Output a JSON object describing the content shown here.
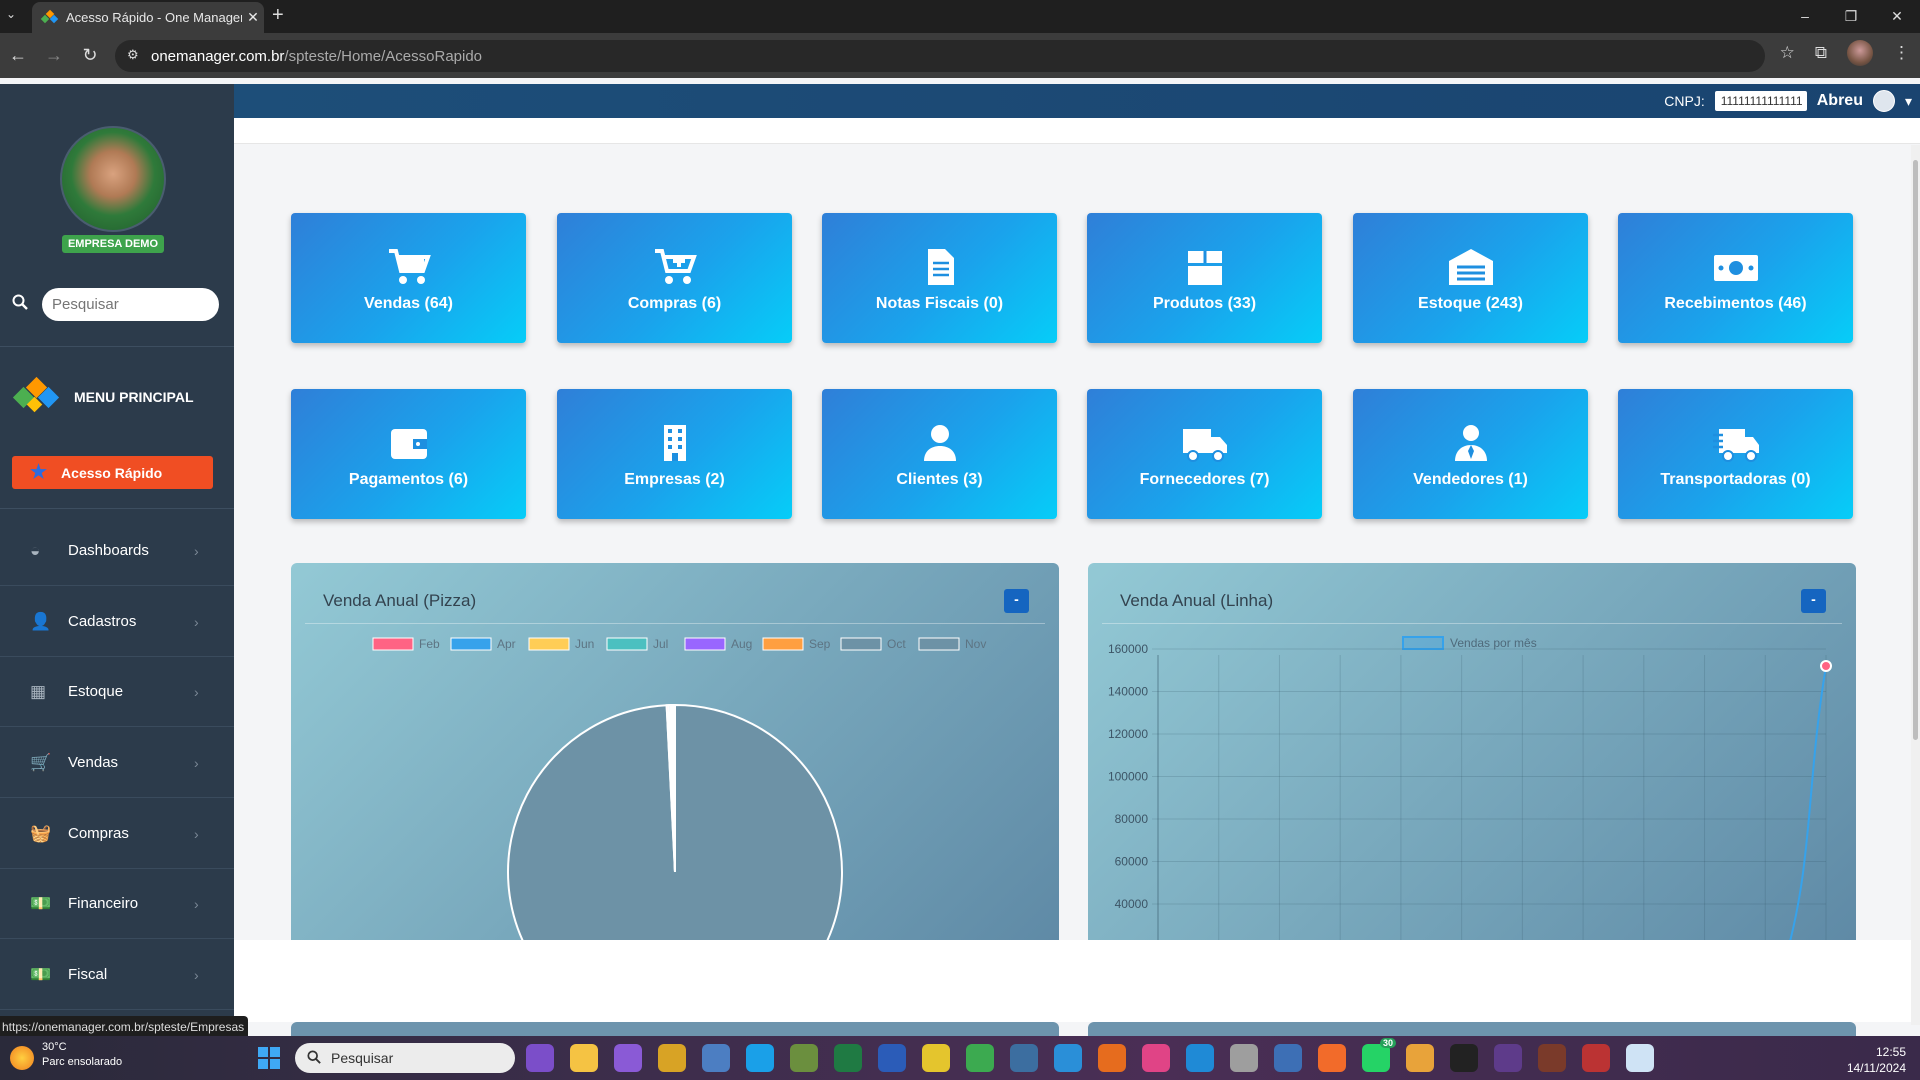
{
  "browser": {
    "tab_title": "Acesso Rápido - One Manager",
    "tab_close": "✕",
    "new_tab": "+",
    "url_domain": "onemanager.com.br",
    "url_path": "/spteste/Home/AcessoRapido",
    "status_url": "https://onemanager.com.br/spteste/Empresas"
  },
  "header": {
    "cnpj_label": "CNPJ:",
    "cnpj_value": "11111111111111",
    "user_name": "Abreu",
    "user_caret": "▾"
  },
  "sidebar": {
    "company_badge": "EMPRESA DEMO",
    "search_placeholder": "Pesquisar",
    "menu_title": "MENU PRINCIPAL",
    "active_item": "Acesso Rápido",
    "items": [
      {
        "label": "Dashboards",
        "icon": "gauge-icon"
      },
      {
        "label": "Cadastros",
        "icon": "user-plus-icon"
      },
      {
        "label": "Estoque",
        "icon": "grid-icon"
      },
      {
        "label": "Vendas",
        "icon": "cart-icon"
      },
      {
        "label": "Compras",
        "icon": "basket-icon"
      },
      {
        "label": "Financeiro",
        "icon": "money-icon"
      },
      {
        "label": "Fiscal",
        "icon": "money-icon"
      }
    ]
  },
  "tiles": [
    {
      "label": "Vendas (64)",
      "icon": "cart-icon"
    },
    {
      "label": "Compras (6)",
      "icon": "cart-plus-icon"
    },
    {
      "label": "Notas Fiscais (0)",
      "icon": "document-icon"
    },
    {
      "label": "Produtos (33)",
      "icon": "box-icon"
    },
    {
      "label": "Estoque (243)",
      "icon": "warehouse-icon"
    },
    {
      "label": "Recebimentos (46)",
      "icon": "money-icon"
    },
    {
      "label": "Pagamentos (6)",
      "icon": "wallet-icon"
    },
    {
      "label": "Empresas (2)",
      "icon": "building-icon"
    },
    {
      "label": "Clientes (3)",
      "icon": "user-icon"
    },
    {
      "label": "Fornecedores (7)",
      "icon": "truck-icon"
    },
    {
      "label": "Vendedores (1)",
      "icon": "user-tie-icon"
    },
    {
      "label": "Transportadoras (0)",
      "icon": "truck-fast-icon"
    }
  ],
  "panels": {
    "pie_title": "Venda Anual (Pizza)",
    "line_title": "Venda Anual (Linha)",
    "collapse_label": "-"
  },
  "chart_data": [
    {
      "type": "pie",
      "legend": [
        {
          "label": "Feb",
          "color": "#ff6384"
        },
        {
          "label": "Apr",
          "color": "#36a2eb"
        },
        {
          "label": "Jun",
          "color": "#ffcd56"
        },
        {
          "label": "Jul",
          "color": "#4bc0c0"
        },
        {
          "label": "Aug",
          "color": "#9966ff"
        },
        {
          "label": "Sep",
          "color": "#ff9f40"
        },
        {
          "label": "Oct",
          "color": "#6d92a6"
        },
        {
          "label": "Nov",
          "color": "#6d92a6"
        }
      ],
      "slices": [
        {
          "label": "Nov",
          "fraction": 0.992
        },
        {
          "label": "Feb",
          "fraction": 0.002
        },
        {
          "label": "Apr",
          "fraction": 0.002
        },
        {
          "label": "Jun",
          "fraction": 0.001
        },
        {
          "label": "Jul",
          "fraction": 0.001
        },
        {
          "label": "Aug",
          "fraction": 0.001
        },
        {
          "label": "Sep",
          "fraction": 0.001
        }
      ],
      "legend_position": "top"
    },
    {
      "type": "line",
      "legend": [
        "Vendas por mês"
      ],
      "legend_position": "top",
      "yticks": [
        160000,
        140000,
        120000,
        100000,
        80000,
        60000,
        40000
      ],
      "ylim": [
        40000,
        160000
      ],
      "series": [
        {
          "name": "Vendas por mês",
          "color": "#36a2eb",
          "points": [
            [
              10.3,
              30000
            ],
            [
              11,
              152000
            ]
          ]
        }
      ],
      "xlim": [
        0,
        11
      ],
      "grid": true
    }
  ],
  "taskbar": {
    "temp": "30°C",
    "weather": "Parc ensolarado",
    "search": "Pesquisar",
    "time": "12:55",
    "date": "14/11/2024",
    "badge": "30"
  },
  "window_controls": {
    "min": "–",
    "max": "❐",
    "close": "✕"
  }
}
